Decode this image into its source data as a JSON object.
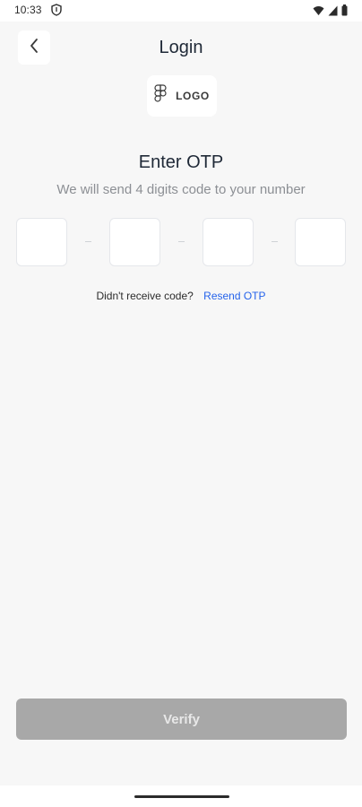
{
  "status_bar": {
    "time": "10:33",
    "left_icon": "shield-icon",
    "right_icons": [
      "wifi-icon",
      "signal-icon",
      "battery-icon"
    ]
  },
  "header": {
    "title": "Login",
    "back_icon": "chevron-left-icon"
  },
  "logo": {
    "icon": "figma-logo-icon",
    "text": "LOGO"
  },
  "otp": {
    "heading": "Enter OTP",
    "subtitle": "We will send 4 digits code to your number",
    "digits": [
      "",
      "",
      "",
      ""
    ]
  },
  "resend": {
    "text": "Didn't receive code?",
    "link": "Resend OTP"
  },
  "verify": {
    "label": "Verify"
  },
  "colors": {
    "background": "#f7f7f7",
    "link": "#2563eb",
    "button_disabled": "#a8a8a8"
  }
}
